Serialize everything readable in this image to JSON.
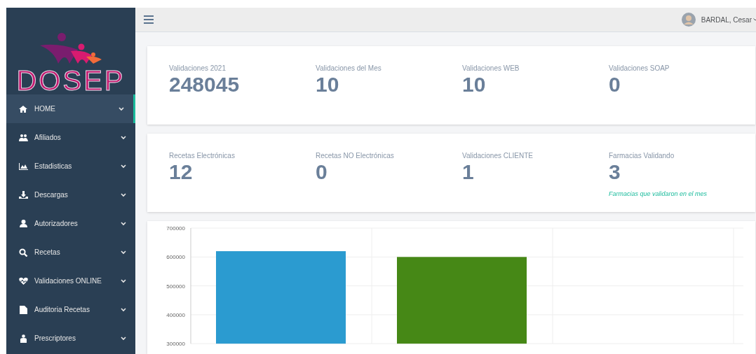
{
  "sidebar": {
    "logo_text": "DOSEP",
    "items": [
      {
        "label": "HOME",
        "selected": true
      },
      {
        "label": "Afiliados",
        "selected": false
      },
      {
        "label": "Estadisticas",
        "selected": false
      },
      {
        "label": "Descargas",
        "selected": false
      },
      {
        "label": "Autorizadores",
        "selected": false
      },
      {
        "label": "Recetas",
        "selected": false
      },
      {
        "label": "Validaciones ONLINE",
        "selected": false
      },
      {
        "label": "Auditoria Recetas",
        "selected": false
      },
      {
        "label": "Prescriptores",
        "selected": false
      }
    ]
  },
  "header": {
    "user": "BARDAL, Cesar"
  },
  "stat_cards": [
    {
      "stats": [
        {
          "label": "Validaciones 2021",
          "value": "248045"
        },
        {
          "label": "Validaciones del Mes",
          "value": "10"
        },
        {
          "label": "Validaciones WEB",
          "value": "10"
        },
        {
          "label": "Validaciones SOAP",
          "value": "0"
        }
      ]
    },
    {
      "stats": [
        {
          "label": "Recetas Electrónicas",
          "value": "12"
        },
        {
          "label": "Recetas NO Electrónicas",
          "value": "0"
        },
        {
          "label": "Validaciones CLIENTE",
          "value": "1"
        },
        {
          "label": "Farmacias Validando",
          "value": "3",
          "note": "Farmacias que validaron en el mes"
        }
      ]
    }
  ],
  "chart": {
    "chart_data": {
      "type": "bar",
      "grid": true,
      "ylim": [
        300000,
        700000
      ],
      "yticks": [
        300000,
        400000,
        500000,
        600000,
        700000
      ],
      "series": [
        {
          "color": "#2b9bd0",
          "values": [
            620000,
            null,
            null
          ]
        },
        {
          "color": "#468816",
          "values": [
            null,
            600000,
            null
          ]
        }
      ]
    }
  }
}
